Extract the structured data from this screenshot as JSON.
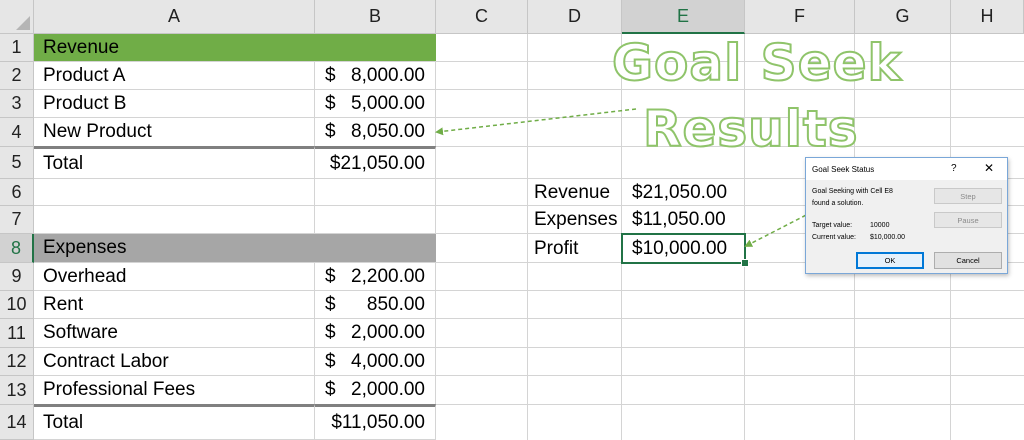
{
  "columns": [
    "A",
    "B",
    "C",
    "D",
    "E",
    "F",
    "G",
    "H"
  ],
  "selected_column": "E",
  "selected_row": "8",
  "rows": [
    "1",
    "2",
    "3",
    "4",
    "5",
    "6",
    "7",
    "8",
    "9",
    "10",
    "11",
    "12",
    "13",
    "14"
  ],
  "revenue_section": {
    "header": "Revenue",
    "items": [
      {
        "label": "Product A",
        "currency": "$",
        "amount": "8,000.00"
      },
      {
        "label": "Product B",
        "currency": "$",
        "amount": "5,000.00"
      },
      {
        "label": "New Product",
        "currency": "$",
        "amount": "8,050.00"
      }
    ],
    "total_label": "Total",
    "total_value": "$21,050.00"
  },
  "expenses_section": {
    "header": "Expenses",
    "items": [
      {
        "label": "Overhead",
        "currency": "$",
        "amount": "2,200.00"
      },
      {
        "label": "Rent",
        "currency": "$",
        "amount": "850.00"
      },
      {
        "label": "Software",
        "currency": "$",
        "amount": "2,000.00"
      },
      {
        "label": "Contract Labor",
        "currency": "$",
        "amount": "4,000.00"
      },
      {
        "label": "Professional Fees",
        "currency": "$",
        "amount": "2,000.00"
      }
    ],
    "total_label": "Total",
    "total_value": "$11,050.00"
  },
  "summary": [
    {
      "label": "Revenue",
      "value": "$21,050.00"
    },
    {
      "label": "Expenses",
      "value": "$11,050.00"
    },
    {
      "label": "Profit",
      "value": "$10,000.00"
    }
  ],
  "overlay_title": {
    "line1": "Goal Seek",
    "line2": "Results"
  },
  "dialog": {
    "title": "Goal Seek Status",
    "help": "?",
    "close": "✕",
    "message_line1": "Goal Seeking with Cell E8",
    "message_line2": "found a solution.",
    "target_label": "Target value:",
    "target_value": "10000",
    "current_label": "Current value:",
    "current_value": "$10,000.00",
    "step_label": "Step",
    "pause_label": "Pause",
    "ok_label": "OK",
    "cancel_label": "Cancel"
  },
  "colors": {
    "revenue_band": "#70ad47",
    "expenses_band": "#a6a6a6",
    "selection": "#217346",
    "arrow": "#70ad47"
  }
}
